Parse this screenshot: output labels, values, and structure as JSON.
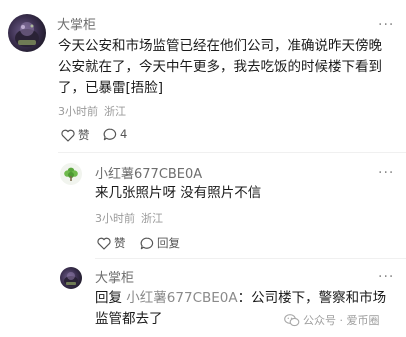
{
  "comment": {
    "author": "大掌柜",
    "text": "今天公安和市场监管已经在他们公司，准确说昨天傍晚公安就在了，今天中午更多，我去吃饭的时候楼下看到了，已暴雷[捂脸]",
    "time": "3小时前",
    "location": "浙江",
    "like_label": "赞",
    "reply_count": "4",
    "more": "···"
  },
  "replies": [
    {
      "author": "小红薯677CBE0A",
      "text": "来几张照片呀 没有照片不信",
      "time": "3小时前",
      "location": "浙江",
      "like_label": "赞",
      "reply_label": "回复",
      "more": "···"
    },
    {
      "author": "大掌柜",
      "reply_prefix": "回复 ",
      "reply_target": "小红薯677CBE0A",
      "text": "：公司楼下，警察和市场监管都去了",
      "more": "···"
    }
  ],
  "watermark": "公众号 · 爱币圈"
}
